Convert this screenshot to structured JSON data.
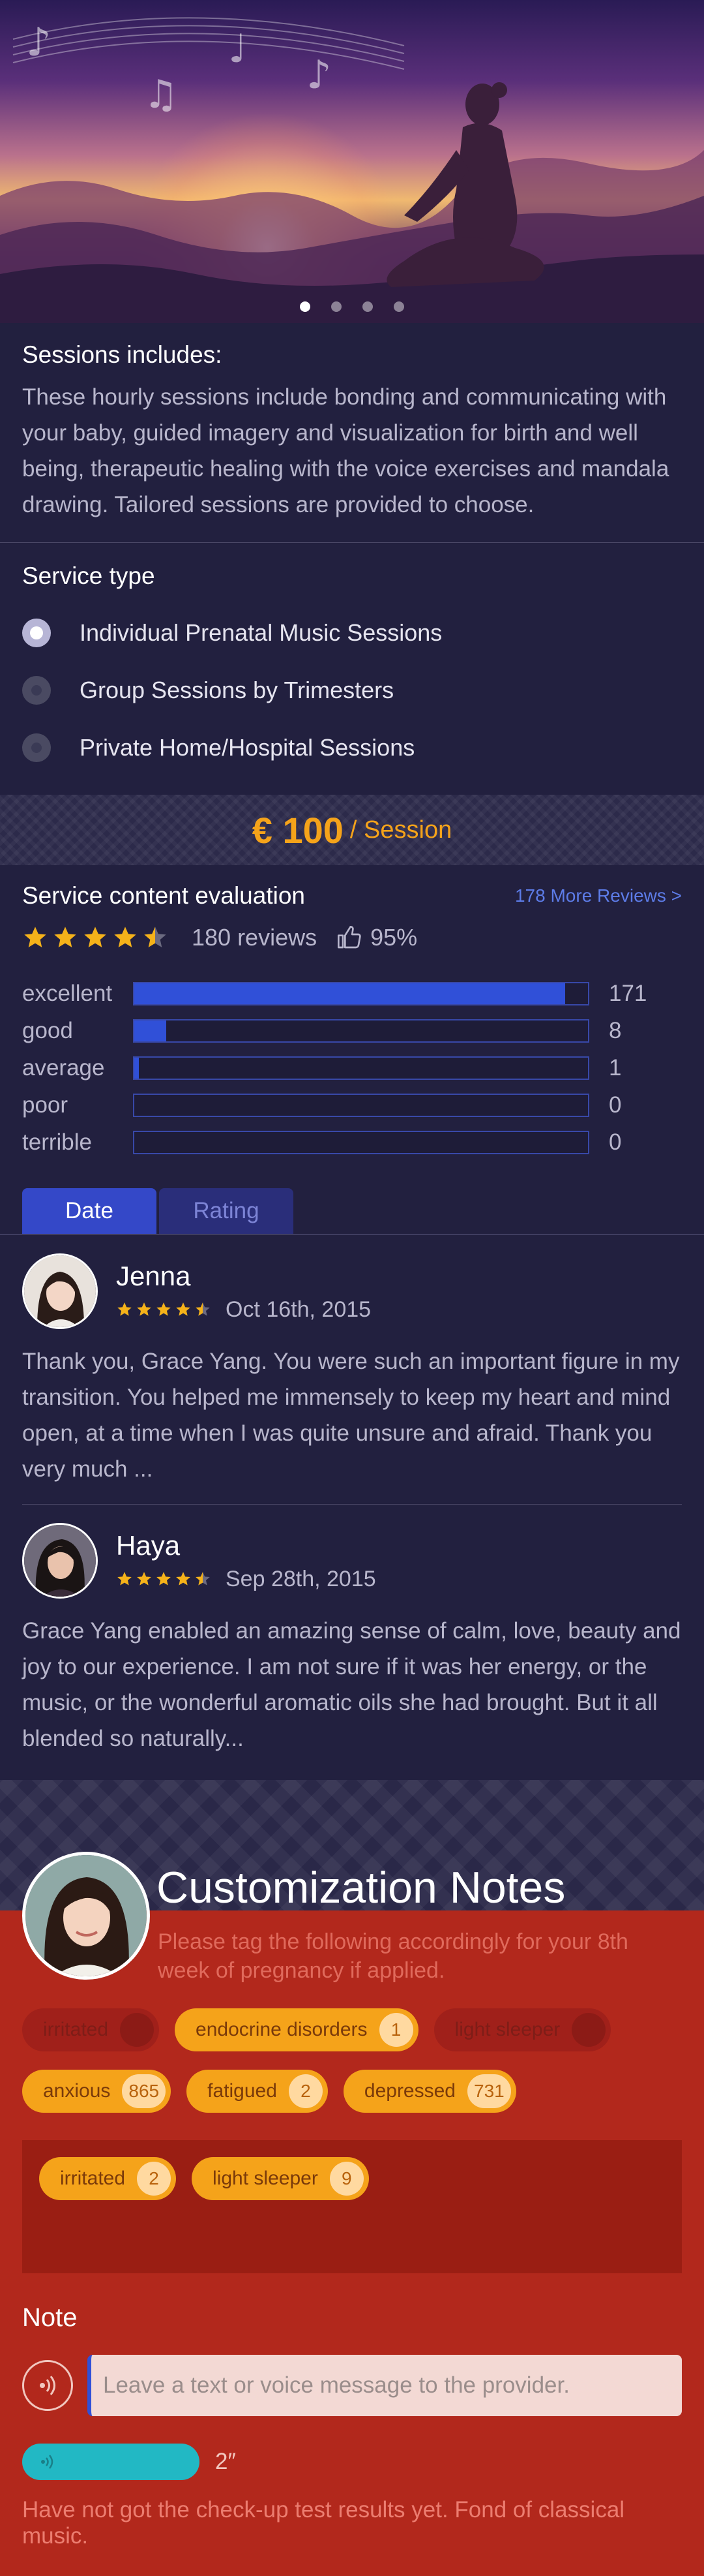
{
  "hero": {
    "slides": 4,
    "active_slide": 0
  },
  "includes": {
    "title": "Sessions includes:",
    "text": "These hourly sessions include bonding and communicating with your baby, guided imagery and visualization for birth and well being, therapeutic healing with the voice exercises and mandala drawing. Tailored sessions are provided to choose."
  },
  "service": {
    "title": "Service type",
    "options": [
      {
        "label": "Individual Prenatal Music Sessions",
        "selected": true
      },
      {
        "label": "Group Sessions by Trimesters",
        "selected": false
      },
      {
        "label": "Private Home/Hospital Sessions",
        "selected": false
      }
    ]
  },
  "price": {
    "amount": "€ 100",
    "unit": "/ Session"
  },
  "evaluation": {
    "title": "Service content evaluation",
    "more": "178 More Reviews  >",
    "rating": 4.5,
    "reviews": "180 reviews",
    "positive": "95%",
    "breakdown": [
      {
        "label": "excellent",
        "count": "171",
        "fraction": 0.95
      },
      {
        "label": "good",
        "count": "8",
        "fraction": 0.07
      },
      {
        "label": "average",
        "count": "1",
        "fraction": 0.01
      },
      {
        "label": "poor",
        "count": "0",
        "fraction": 0
      },
      {
        "label": "terrible",
        "count": "0",
        "fraction": 0
      }
    ],
    "tabs": [
      {
        "label": "Date",
        "active": true
      },
      {
        "label": "Rating",
        "active": false
      }
    ]
  },
  "reviews": [
    {
      "name": "Jenna",
      "date": "Oct 16th, 2015",
      "rating": 4.5,
      "text": "Thank you, Grace Yang. You were such an important figure in my transition. You helped me immensely to keep my heart and mind open, at a time when I was quite unsure and afraid. Thank you very much ..."
    },
    {
      "name": "Haya",
      "date": "Sep 28th, 2015",
      "rating": 4.5,
      "text": "Grace Yang enabled an amazing sense of calm, love, beauty and joy to our experience. I am not sure if it was her energy, or the music, or the wonderful aromatic oils she had brought. But it all blended so naturally..."
    }
  ],
  "customization": {
    "title": "Customization Notes",
    "subtitle": "Please tag the following accordingly for your 8th week of pregnancy if applied.",
    "tags": [
      {
        "label": "irritated",
        "count": "",
        "dim": true
      },
      {
        "label": "endocrine disorders",
        "count": "1",
        "dim": false
      },
      {
        "label": "light sleeper",
        "count": "",
        "dim": true
      },
      {
        "label": "anxious",
        "count": "865",
        "dim": false
      },
      {
        "label": "fatigued",
        "count": "2",
        "dim": false
      },
      {
        "label": "depressed",
        "count": "731",
        "dim": false
      }
    ],
    "selected_tags": [
      {
        "label": "irritated",
        "count": "2"
      },
      {
        "label": "light sleeper",
        "count": "9"
      }
    ],
    "note_title": "Note",
    "note_placeholder": "Leave a text or voice message to the provider.",
    "voice_duration": "2″",
    "note_text": "Have not got the check-up test results yet. Fond of classical music."
  },
  "colors": {
    "accent": "#f5a31a",
    "bar": "#3050d8",
    "red": "#b2281c",
    "bg": "#22203f"
  }
}
